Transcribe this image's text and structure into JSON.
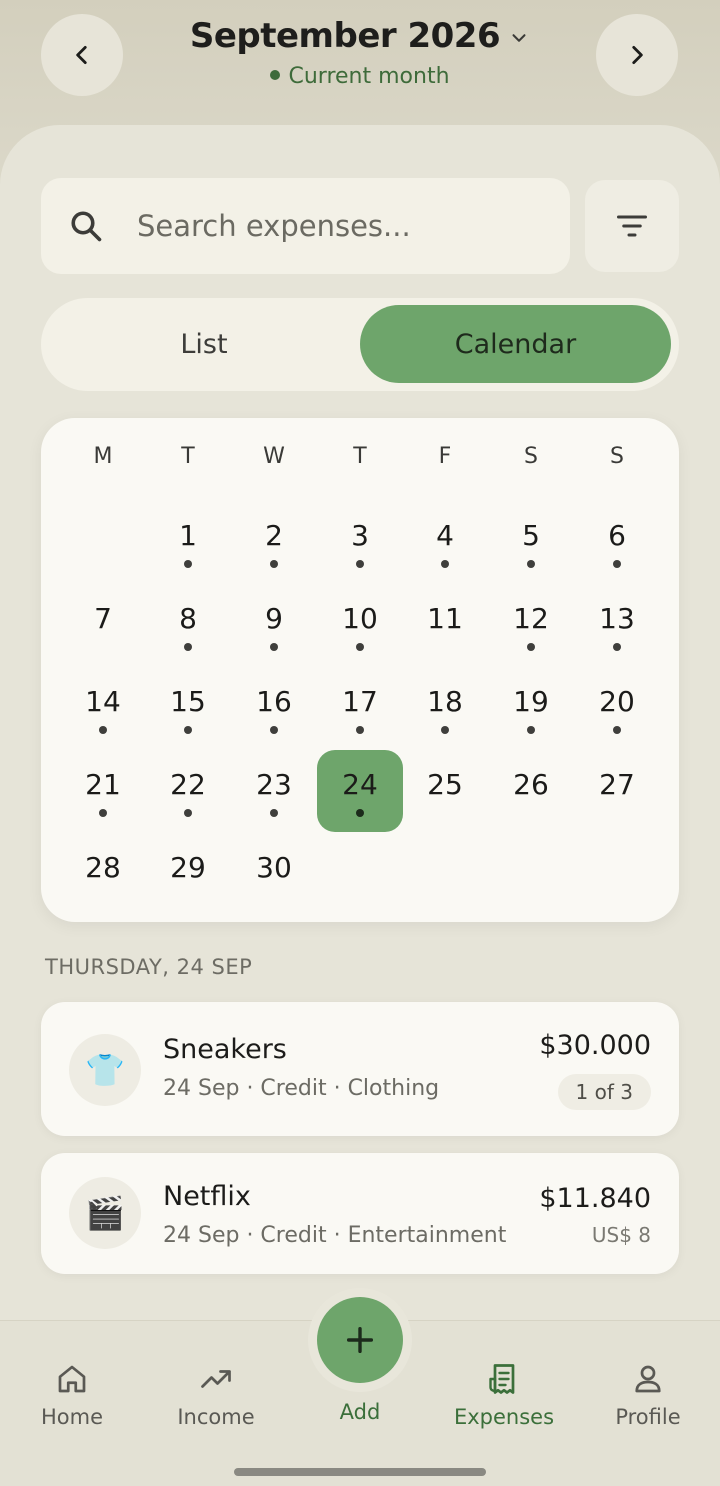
{
  "header": {
    "month": "September 2026",
    "status": "Current month"
  },
  "search": {
    "placeholder": "Search expenses..."
  },
  "view_toggle": {
    "list": "List",
    "calendar": "Calendar",
    "selected": "Calendar"
  },
  "calendar": {
    "weekdays": [
      "M",
      "T",
      "W",
      "T",
      "F",
      "S",
      "S"
    ],
    "first_weekday_index": 1,
    "days": 30,
    "selected_day": 24,
    "days_with_expenses": [
      1,
      2,
      3,
      4,
      5,
      6,
      8,
      9,
      10,
      12,
      13,
      14,
      15,
      16,
      17,
      18,
      19,
      20,
      21,
      22,
      23,
      24
    ]
  },
  "section": {
    "label": "THURSDAY, 24 SEP"
  },
  "expenses": [
    {
      "icon": "t-shirt",
      "emoji": "👕",
      "name": "Sneakers",
      "meta": "24 Sep · Credit · Clothing",
      "amount": "$30.000",
      "badge": "1 of 3"
    },
    {
      "icon": "clapper-board",
      "emoji": "🎬",
      "name": "Netflix",
      "meta": "24 Sep · Credit · Entertainment",
      "amount": "$11.840",
      "secondary": "US$ 8"
    }
  ],
  "bottom_nav": {
    "home": "Home",
    "income": "Income",
    "add": "Add",
    "expenses": "Expenses",
    "profile": "Profile",
    "active": "Expenses"
  },
  "colors": {
    "accent": "#6ea56b",
    "accent_text": "#3b6f3a",
    "background": "#e6e4d8",
    "card": "#faf9f4"
  }
}
